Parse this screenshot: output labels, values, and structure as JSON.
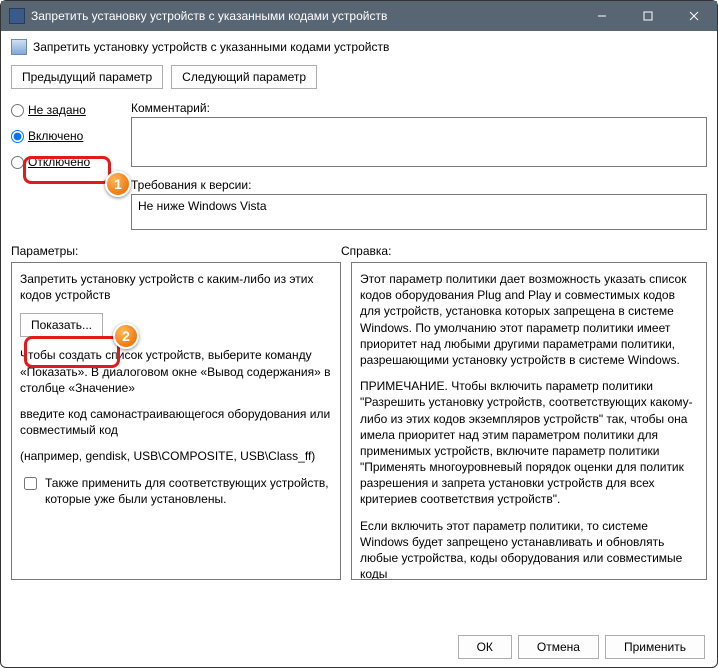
{
  "window": {
    "title": "Запретить установку устройств с указанными кодами устройств"
  },
  "subheader": {
    "text": "Запретить установку устройств с указанными кодами устройств"
  },
  "nav": {
    "prev": "Предыдущий параметр",
    "next": "Следующий параметр"
  },
  "state": {
    "not_configured": "Не задано",
    "enabled": "Включено",
    "disabled": "Отключено"
  },
  "comment": {
    "label": "Комментарий:"
  },
  "requirements": {
    "label": "Требования к версии:",
    "value": "Не ниже Windows Vista"
  },
  "labels": {
    "params": "Параметры:",
    "help": "Справка:"
  },
  "params": {
    "p1": "Запретить установку устройств с каким-либо из этих кодов устройств",
    "show_btn": "Показать...",
    "p2": "Чтобы создать список устройств, выберите команду «Показать». В диалоговом окне «Вывод содержания» в столбце «Значение»",
    "p3": "введите код самонастраивающегося оборудования или совместимый код",
    "p4": "(например, gendisk, USB\\COMPOSITE, USB\\Class_ff)",
    "checkbox": "Также применить для соответствующих устройств, которые уже были установлены."
  },
  "help": {
    "h1": "Этот параметр политики дает возможность указать список кодов оборудования Plug and Play и совместимых кодов для устройств, установка которых запрещена в системе Windows. По умолчанию этот параметр политики имеет приоритет над любыми другими параметрами политики, разрешающими установку устройств в системе Windows.",
    "h2": "ПРИМЕЧАНИЕ. Чтобы включить параметр политики \"Разрешить установку устройств, соответствующих какому-либо из этих кодов экземпляров устройств\" так, чтобы она имела приоритет над этим параметром политики для применимых устройств, включите параметр политики \"Применять многоуровневый порядок оценки для политик разрешения и запрета установки устройств для всех критериев соответствия устройств\".",
    "h3": "Если включить этот параметр политики, то системе Windows будет запрещено устанавливать и обновлять любые устройства, коды оборудования или совместимые коды"
  },
  "buttons": {
    "ok": "ОК",
    "cancel": "Отмена",
    "apply": "Применить"
  }
}
